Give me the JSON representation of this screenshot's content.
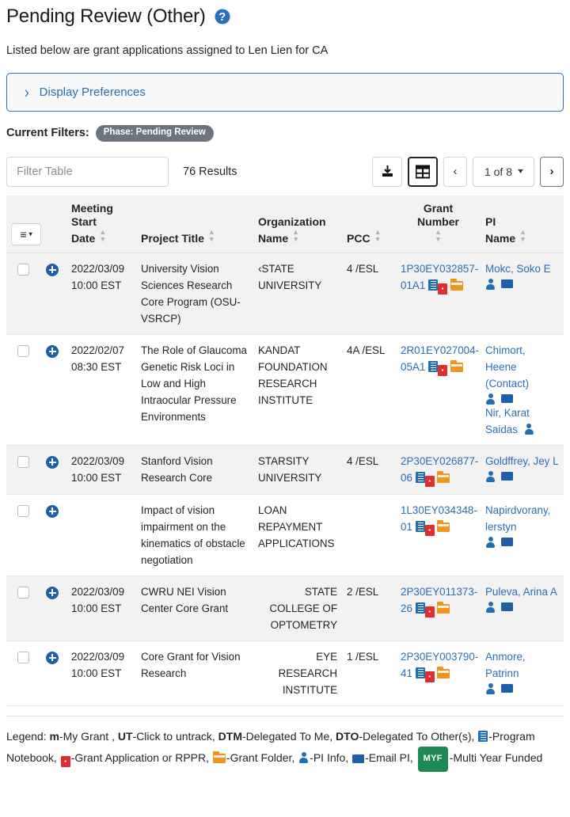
{
  "header": {
    "title": "Pending Review (Other)",
    "help_icon": "help-question-icon",
    "subtitle": "Listed below are grant applications assigned to Len Lien for CA"
  },
  "display_preferences": {
    "label": "Display Preferences",
    "chevron": "chevron-right-icon",
    "expanded": false
  },
  "current_filters": {
    "label": "Current Filters:",
    "chips": [
      "Phase: Pending Review"
    ]
  },
  "toolbar": {
    "filter_placeholder": "Filter Table",
    "filter_value": "",
    "results_text": "76 Results",
    "download_icon": "download-icon",
    "grid_icon": "grid-view-icon",
    "prev_label": "‹",
    "next_label": "›",
    "page_label": "1 of 8",
    "page_caret": "chevron-down-icon"
  },
  "table": {
    "menu_button": {
      "bars": "≡",
      "caret": "▾"
    },
    "columns": [
      {
        "label": "Meeting\nStart\nDate",
        "sortable": true
      },
      {
        "label": "Project Title",
        "sortable": true
      },
      {
        "label": "Organization\nName",
        "sortable": true
      },
      {
        "label": "PCC",
        "sortable": true
      },
      {
        "label": "Grant\nNumber",
        "sortable": true
      },
      {
        "label": "PI\nName",
        "sortable": true
      }
    ],
    "rows": [
      {
        "shaded": true,
        "meeting_date": "2022/03/09\n10:00 EST",
        "project_title": "University Vision Sciences Research Core Program (OSU-VSRCP)",
        "organization": "‹STATE UNIVERSITY",
        "org_align": "left",
        "pcc": "4 /ESL",
        "grant_number": "1P30EY032857-01A1",
        "pi_names": [
          "Mokc, Soko E"
        ],
        "pi_has_mail": true
      },
      {
        "shaded": false,
        "meeting_date": "2022/02/07\n08:30 EST",
        "project_title": "The Role of Glaucoma Genetic Risk Loci in Low and High Intraocular Pressure Environments",
        "organization": "KANDAT FOUNDATION RESEARCH INSTITUTE",
        "org_align": "left",
        "pcc": "4A /ESL",
        "grant_number": "2R01EY027004-05A1",
        "pi_names": [
          "Chimort, Heene (Contact)",
          "Nir, Karat Saidas"
        ],
        "pi_has_mail": true
      },
      {
        "shaded": true,
        "meeting_date": "2022/03/09\n10:00 EST",
        "project_title": "Stanford Vision Research Core",
        "organization": "STARSITY UNIVERSITY",
        "org_align": "left",
        "pcc": "4 /ESL",
        "grant_number": "2P30EY026877-06",
        "pi_names": [
          "Goldffrey, Jey L"
        ],
        "pi_has_mail": true
      },
      {
        "shaded": false,
        "meeting_date": "",
        "project_title": "Impact of vision impairment on the kinematics of obstacle negotiation",
        "organization": "LOAN REPAYMENT APPLICATIONS",
        "org_align": "left",
        "pcc": "",
        "grant_number": "1L30EY034348-01",
        "pi_names": [
          "Napirdvorany, lerstyn"
        ],
        "pi_has_mail": true
      },
      {
        "shaded": true,
        "meeting_date": "2022/03/09\n10:00 EST",
        "project_title": "CWRU NEI Vision Center Core Grant",
        "organization": "STATE COLLEGE OF OPTOMETRY",
        "org_align": "right",
        "pcc": "2 /ESL",
        "grant_number": "2P30EY011373-26",
        "pi_names": [
          "Puleva, Arina A"
        ],
        "pi_has_mail": true
      },
      {
        "shaded": false,
        "meeting_date": "2022/03/09\n10:00 EST",
        "project_title": "Core Grant for Vision Research",
        "organization": "EYE RESEARCH INSTITUTE",
        "org_align": "right",
        "pcc": "1 /ESL",
        "grant_number": "2P30EY003790-41",
        "pi_names": [
          "Anmore, Patrinn"
        ],
        "pi_has_mail": true
      }
    ]
  },
  "legend": {
    "prefix": "Legend:",
    "items": [
      {
        "key": "m",
        "bold": true,
        "text": "-My Grant ,"
      },
      {
        "key": "UT",
        "bold": true,
        "text": "-Click to untrack,"
      },
      {
        "key": "DTM",
        "bold": true,
        "text": "-Delegated To Me,"
      },
      {
        "key": "DTO",
        "bold": true,
        "text": "-Delegated To Other(s),"
      }
    ],
    "icon_items": [
      {
        "icon": "program-notebook-icon",
        "text": "-Program Notebook,"
      },
      {
        "icon": "pdf-icon",
        "text": "-Grant Application or RPPR,"
      },
      {
        "icon": "folder-icon",
        "text": "-Grant Folder,"
      },
      {
        "icon": "pi-info-icon",
        "text": "-PI Info,"
      },
      {
        "icon": "email-pi-icon",
        "text": "-Email PI,"
      }
    ],
    "myf_badge": "MYF",
    "myf_text": "-Multi Year Funded"
  },
  "colors": {
    "link": "#2a6eb5",
    "chip_bg": "#6c757d",
    "row_shade": "#f2f2f2",
    "pdf_red": "#e02d2d",
    "folder_orange": "#f0941f",
    "myf_green": "#1d8a54"
  }
}
